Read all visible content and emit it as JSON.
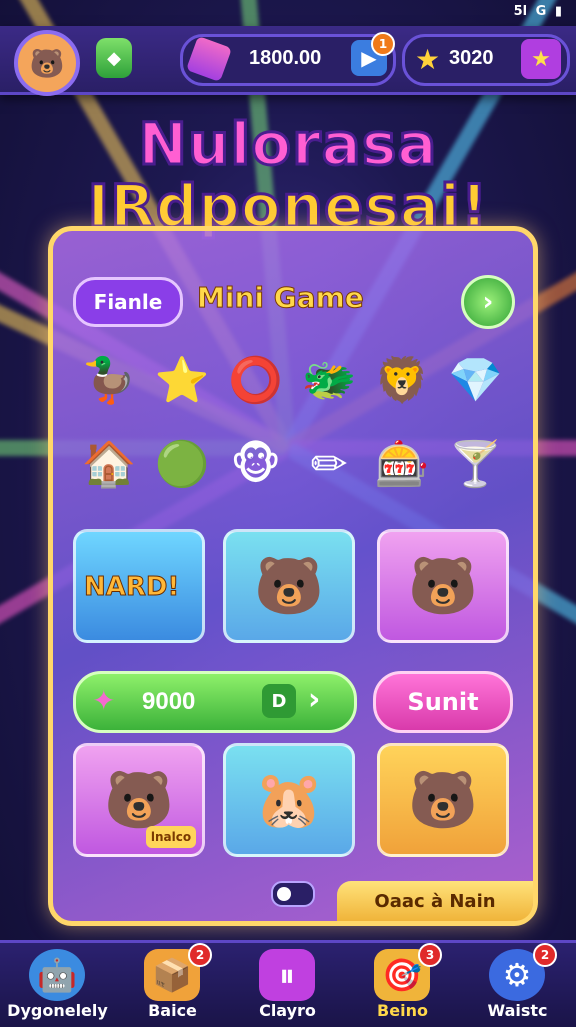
{
  "status_bar": {
    "signal": "5l",
    "wifi": "G",
    "battery": "▮"
  },
  "top_bar": {
    "avatar_icon": "bear-face-icon",
    "gem_button_icon": "green-gem-icon",
    "currency1": {
      "value": "1800.00",
      "badge": "1"
    },
    "currency2": {
      "value": "3020"
    }
  },
  "title": {
    "line1": "Nulorasa",
    "line2": "IRdponesai!"
  },
  "panel": {
    "chip_label": "Fianle",
    "section_title": "Mini Game",
    "icons": [
      "duck",
      "star-wand",
      "ring",
      "dragon",
      "lion",
      "crystal",
      "house",
      "ring2",
      "monster",
      "pencil",
      "machine",
      "cup"
    ],
    "cards_row1": [
      {
        "text": "NARD!"
      },
      {
        "text": ""
      },
      {
        "text": ""
      }
    ],
    "pill_value": "9000",
    "pill_button": "D",
    "submit_label": "Sunit",
    "card_tag": "lnalco",
    "footer_label": "Oaac à Nain"
  },
  "nav": [
    {
      "label": "Dygonelely",
      "badge": ""
    },
    {
      "label": "Baice",
      "badge": "2"
    },
    {
      "label": "Clayro",
      "badge": ""
    },
    {
      "label": "Beino",
      "badge": "3"
    },
    {
      "label": "Waistc",
      "badge": "2"
    }
  ],
  "colors": {
    "accent": "#ffd76a",
    "panel": "#9c6ce6",
    "nav_bg": "#2b2170"
  }
}
